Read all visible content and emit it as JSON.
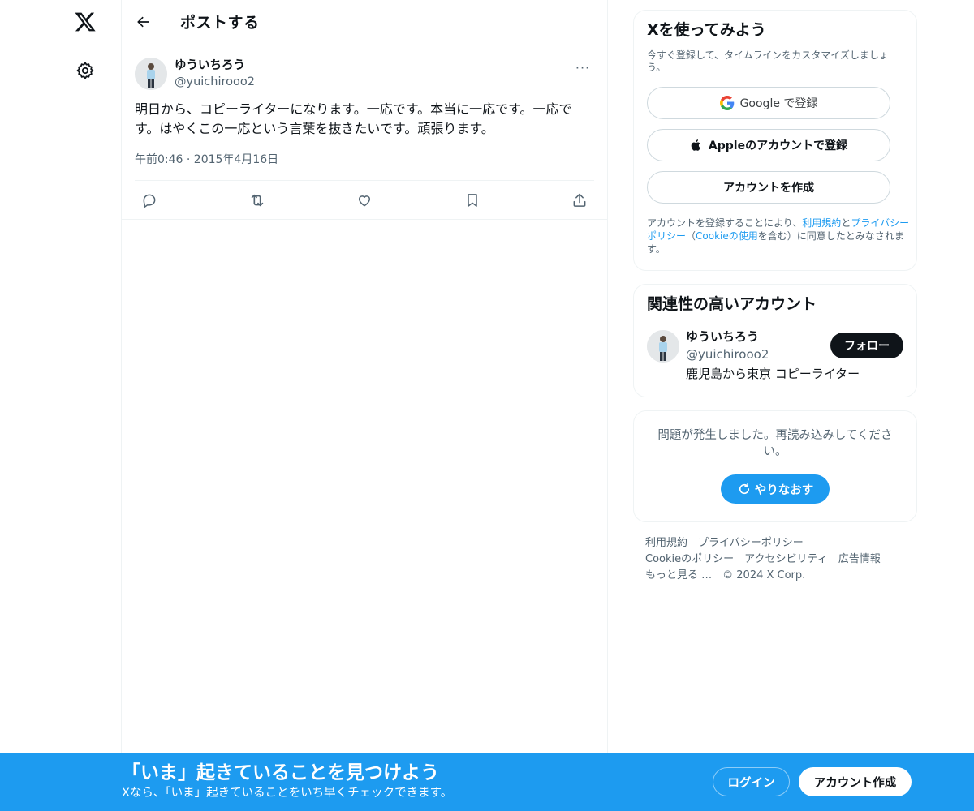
{
  "nav": {
    "logo_icon": "x-logo-icon",
    "settings_icon": "gear-icon"
  },
  "header": {
    "title": "ポストする",
    "back_icon": "arrow-left-icon"
  },
  "post": {
    "author_name": "ゆういちろう",
    "author_handle": "@yuichirooo2",
    "more_label": "···",
    "text": "明日から、コピーライターになります。一応です。本当に一応です。一応です。はやくこの一応という言葉を抜きたいです。頑張ります。",
    "timestamp": "午前0:46 · 2015年4月16日",
    "actions": [
      "reply-icon",
      "repost-icon",
      "like-icon",
      "bookmark-icon",
      "share-icon"
    ]
  },
  "signup": {
    "title": "Xを使ってみよう",
    "subtitle": "今すぐ登録して、タイムラインをカスタマイズしましょう。",
    "google_label": "Google で登録",
    "apple_label": "Appleのアカウントで登録",
    "create_label": "アカウントを作成",
    "legal_prefix": "アカウントを登録することにより、",
    "legal_terms": "利用規約",
    "legal_and": "と",
    "legal_privacy": "プライバシーポリシー",
    "legal_open": "（",
    "legal_cookie": "Cookieの使用",
    "legal_suffix": "を含む）に同意したとみなされます。"
  },
  "related": {
    "title": "関連性の高いアカウント",
    "name": "ゆういちろう",
    "handle": "@yuichirooo2",
    "bio": "鹿児島から東京 コピーライター",
    "follow_label": "フォロー"
  },
  "error": {
    "message": "問題が発生しました。再読み込みしてください。",
    "retry_label": "やりなおす"
  },
  "footer": {
    "terms": "利用規約",
    "privacy": "プライバシーポリシー",
    "cookie": "Cookieのポリシー",
    "accessibility": "アクセシビリティ",
    "ads": "広告情報",
    "more": "もっと見る …",
    "copyright": "© 2024 X Corp."
  },
  "banner": {
    "title": "「いま」起きていることを見つけよう",
    "subtitle": "Xなら、「いま」起きていることをいち早くチェックできます。",
    "login_label": "ログイン",
    "signup_label": "アカウント作成"
  },
  "colors": {
    "accent": "#1d9bf0",
    "text": "#0f1419",
    "muted": "#536471",
    "border": "#eff3f4"
  }
}
